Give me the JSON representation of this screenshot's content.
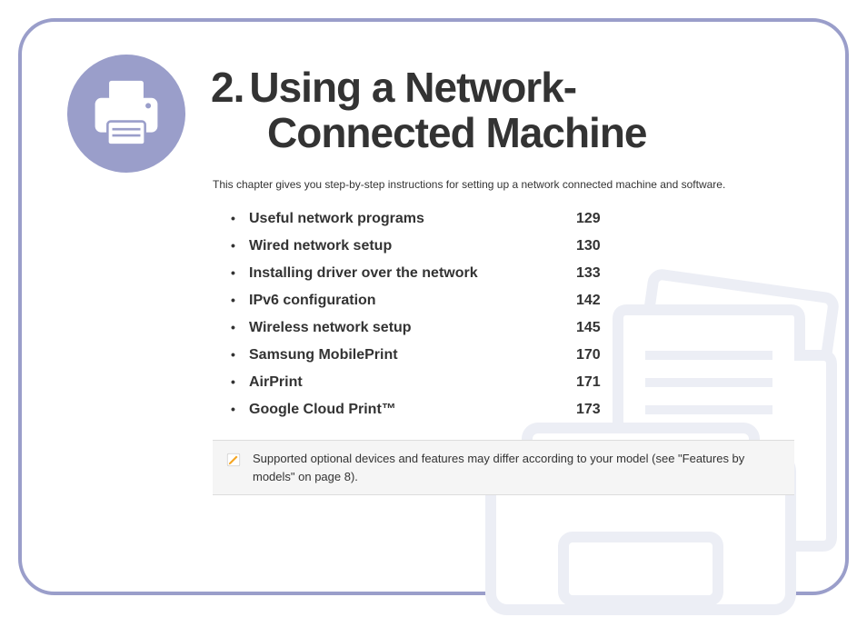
{
  "chapter": {
    "number": "2.",
    "title_line1": "Using a Network-",
    "title_line2": "Connected Machine"
  },
  "intro": "This chapter gives you step-by-step instructions for setting up a network connected machine and software.",
  "toc": [
    {
      "label": "Useful network programs",
      "page": "129"
    },
    {
      "label": "Wired network setup",
      "page": "130"
    },
    {
      "label": "Installing driver over the network",
      "page": "133"
    },
    {
      "label": "IPv6 configuration",
      "page": "142"
    },
    {
      "label": "Wireless network setup",
      "page": "145"
    },
    {
      "label": "Samsung MobilePrint",
      "page": "170"
    },
    {
      "label": "AirPrint",
      "page": "171"
    },
    {
      "label": "Google Cloud Print™",
      "page": "173"
    }
  ],
  "note": "Supported optional devices and features may differ according to your model (see \"Features by models\" on page 8)."
}
